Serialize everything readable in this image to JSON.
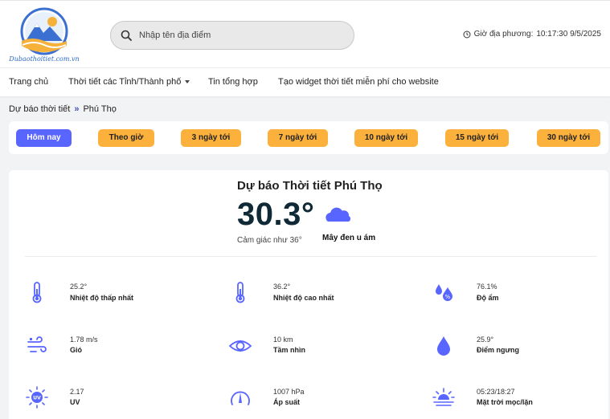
{
  "header": {
    "logo_text": "Dubaothoitiet.com.vn",
    "search_placeholder": "Nhập tên địa điểm",
    "clock_label": "Giờ địa phương:",
    "clock_value": "10:17:30 9/5/2025"
  },
  "nav": {
    "items": [
      {
        "label": "Trang chủ"
      },
      {
        "label": "Thời tiết các Tỉnh/Thành phố"
      },
      {
        "label": "Tin tổng hợp"
      },
      {
        "label": "Tạo widget thời tiết miễn phí cho website"
      }
    ]
  },
  "breadcrumb": {
    "root": "Dự báo thời tiết",
    "separator": "»",
    "current": "Phú Thọ"
  },
  "tabs": [
    {
      "label": "Hôm nay",
      "active": true
    },
    {
      "label": "Theo giờ"
    },
    {
      "label": "3 ngày tới"
    },
    {
      "label": "7 ngày tới"
    },
    {
      "label": "10 ngày tới"
    },
    {
      "label": "15 ngày tới"
    },
    {
      "label": "30 ngày tới"
    }
  ],
  "current": {
    "title": "Dự báo Thời tiết Phú Thọ",
    "temperature": "30.3°",
    "description": "Mây đen u ám",
    "feels_like": "Cảm giác như 36°"
  },
  "stats": [
    {
      "icon": "thermometer-icon",
      "value": "25.2°",
      "label": "Nhiệt độ thấp nhất"
    },
    {
      "icon": "thermometer-icon",
      "value": "36.2°",
      "label": "Nhiệt độ cao nhất"
    },
    {
      "icon": "humidity-icon",
      "value": "76.1%",
      "label": "Độ ẩm"
    },
    {
      "icon": "wind-icon",
      "value": "1.78 m/s",
      "label": "Gió"
    },
    {
      "icon": "eye-icon",
      "value": "10 km",
      "label": "Tầm nhìn"
    },
    {
      "icon": "drop-icon",
      "value": "25.9°",
      "label": "Điểm ngưng"
    },
    {
      "icon": "uv-icon",
      "value": "2.17",
      "label": "UV"
    },
    {
      "icon": "pressure-icon",
      "value": "1007 hPa",
      "label": "Áp suất"
    },
    {
      "icon": "sunrise-icon",
      "value": "05:23/18:27",
      "label": "Mặt trời mọc/lặn"
    }
  ],
  "colors": {
    "accent": "#5866ff",
    "tab": "#fbb13c",
    "icon": "#5866ff"
  }
}
